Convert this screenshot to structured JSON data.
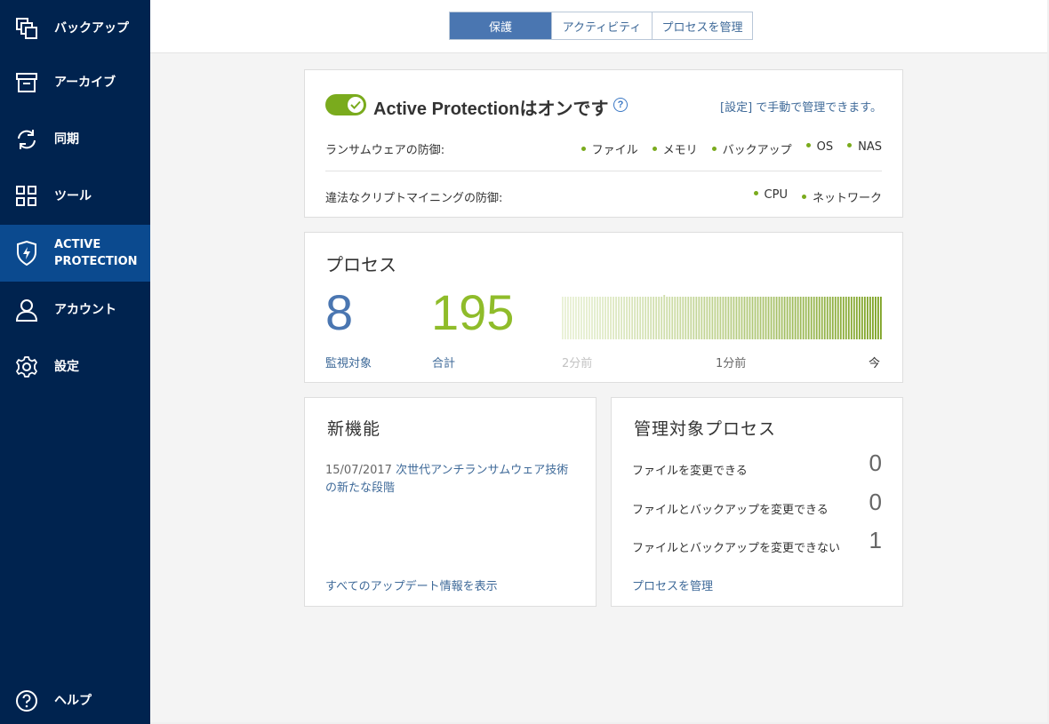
{
  "sidebar": {
    "items": [
      {
        "label": "バックアップ",
        "icon": "backup-icon"
      },
      {
        "label": "アーカイブ",
        "icon": "archive-icon"
      },
      {
        "label": "同期",
        "icon": "sync-icon"
      },
      {
        "label": "ツール",
        "icon": "tools-grid-icon"
      },
      {
        "label": "ACTIVE PROTECTION",
        "icon": "shield-icon"
      },
      {
        "label": "アカウント",
        "icon": "account-icon"
      },
      {
        "label": "設定",
        "icon": "gear-icon"
      }
    ],
    "help": {
      "label": "ヘルプ",
      "icon": "help-icon"
    }
  },
  "tabs": [
    "保護",
    "アクティビティ",
    "プロセスを管理"
  ],
  "protection": {
    "title": "Active Protectionはオンです",
    "settings_link": "[設定] で手動で管理できます。",
    "ransomware_label": "ランサムウェアの防御:",
    "ransomware_items": [
      "ファイル",
      "メモリ",
      "バックアップ",
      "OS",
      "NAS"
    ],
    "crypto_label": "違法なクリプトマイニングの防御:",
    "crypto_items": [
      "CPU",
      "ネットワーク"
    ]
  },
  "process": {
    "title": "プロセス",
    "monitored_count": "8",
    "monitored_label": "監視対象",
    "total_count": "195",
    "total_label": "合計",
    "time_labels": [
      "2分前",
      "1分前",
      "今"
    ]
  },
  "news": {
    "title": "新機能",
    "item_date": "15/07/2017",
    "item_text": "次世代アンチランサムウェア技術の新たな段階",
    "all_updates_link": "すべてのアップデート情報を表示"
  },
  "managed": {
    "title": "管理対象プロセス",
    "rows": [
      {
        "label": "ファイルを変更できる",
        "value": "0"
      },
      {
        "label": "ファイルとバックアップを変更できる",
        "value": "0"
      },
      {
        "label": "ファイルとバックアップを変更できない",
        "value": "1"
      }
    ],
    "manage_link": "プロセスを管理"
  },
  "colors": {
    "sidebar_bg": "#00234f",
    "active_bg": "#0b4a8f",
    "accent_blue": "#4a76b1",
    "accent_green": "#7aab1d"
  }
}
